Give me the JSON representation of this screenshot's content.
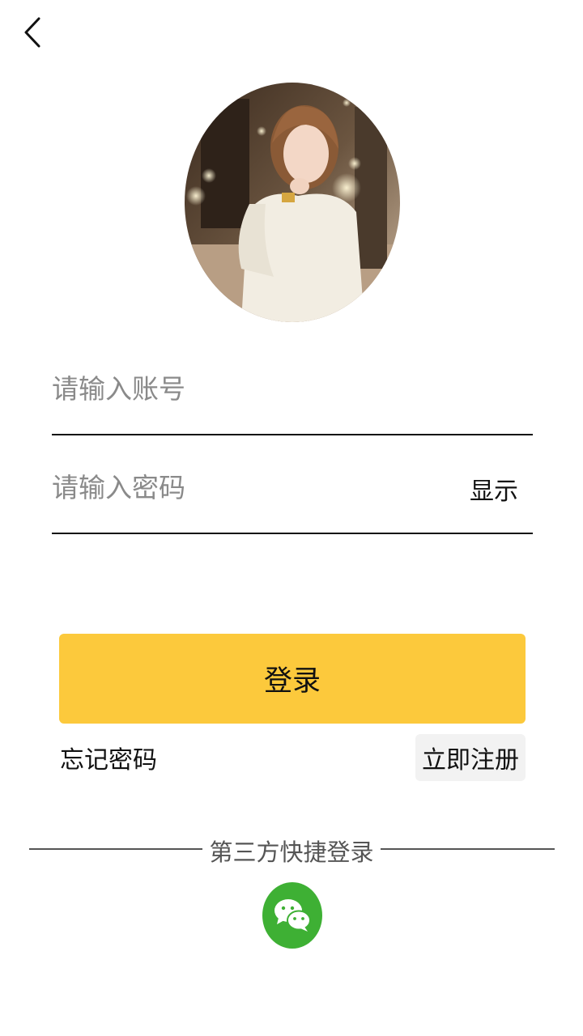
{
  "header": {
    "back_icon": "chevron-left-icon"
  },
  "avatar": {
    "alt": "user avatar photo"
  },
  "login_form": {
    "account_placeholder": "请输入账号",
    "password_placeholder": "请输入密码",
    "show_password_label": "显示",
    "login_button_label": "登录",
    "forgot_password_label": "忘记密码",
    "register_label": "立即注册"
  },
  "third_party": {
    "label": "第三方快捷登录",
    "wechat_icon": "wechat-icon"
  },
  "colors": {
    "accent": "#fcc93c",
    "wechat": "#3eb034",
    "divider": "#555555",
    "placeholder": "#8a8a8a"
  }
}
